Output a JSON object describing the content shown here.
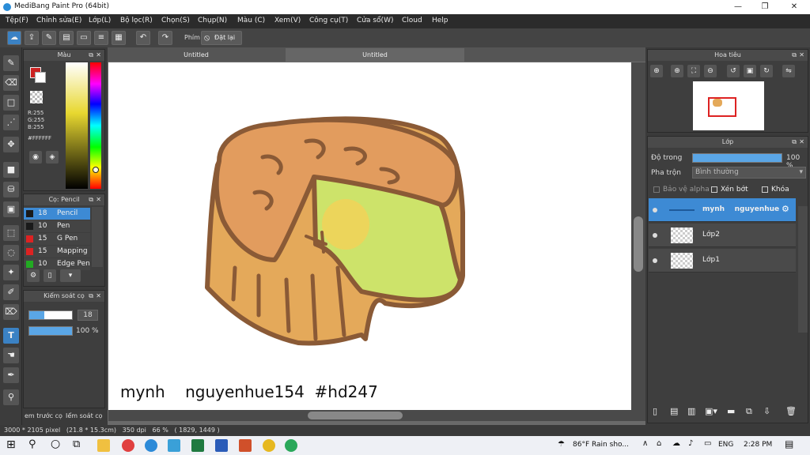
{
  "app": {
    "title": "MediBang Paint Pro (64bit)"
  },
  "menu": [
    "Tệp(F)",
    "Chỉnh sửa(E)",
    "Lớp(L)",
    "Bộ lọc(R)",
    "Chọn(S)",
    "Chụp(N)",
    "Màu (C)",
    "Xem(V)",
    "Công cụ(T)",
    "Cửa sổ(W)",
    "Cloud",
    "Help"
  ],
  "toolbar": {
    "phim_label": "Phím",
    "reset_label": "Đặt lại"
  },
  "doc_tabs": [
    "Untitled",
    "Untitled"
  ],
  "color_panel": {
    "title": "Màu",
    "r": "R:255",
    "g": "G:255",
    "b": "B:255",
    "hex": "#FFFFFF",
    "primary": "#cc2222",
    "secondary": "#ffffff"
  },
  "brush_panel": {
    "title": "Cọ: Pencil",
    "items": [
      {
        "size": "18",
        "name": "Pencil",
        "color": "#1a1a1a"
      },
      {
        "size": "10",
        "name": "Pen",
        "color": "#1a1a1a"
      },
      {
        "size": "15",
        "name": "G Pen",
        "color": "#d22"
      },
      {
        "size": "15",
        "name": "Mapping P",
        "color": "#d22"
      },
      {
        "size": "10",
        "name": "Edge Pen",
        "color": "#2a2"
      }
    ]
  },
  "brush_control": {
    "title": "Kiểm soát cọ",
    "size": "18",
    "opacity": "100 %"
  },
  "left_bottom_tabs": [
    "em trước cọ",
    "Iểm soát cọ"
  ],
  "navigator": {
    "title": "Hoa tiêu"
  },
  "layers_panel": {
    "title": "Lớp",
    "opacity_label": "Độ trong",
    "opacity_value": "100 %",
    "blend_label": "Pha trộn",
    "blend_value": "Bình thường",
    "protect_alpha": "Bảo vệ alpha",
    "clip": "Xén bớt",
    "lock": "Khóa"
  },
  "layers": [
    {
      "name": "mynh    nguyenhue",
      "selected": true
    },
    {
      "name": "Lớp2",
      "selected": false
    },
    {
      "name": "Lớp1",
      "selected": false
    }
  ],
  "canvas": {
    "caption": "mynh    nguyenhue154  #hd247"
  },
  "status": {
    "text": "3000 * 2105 pixel   (21.8 * 15.3cm)   350 dpi   66 %   ( 1829, 1449 )"
  },
  "taskbar": {
    "weather": "86°F  Rain sho...",
    "lang": "ENG",
    "time": "2:28 PM"
  }
}
